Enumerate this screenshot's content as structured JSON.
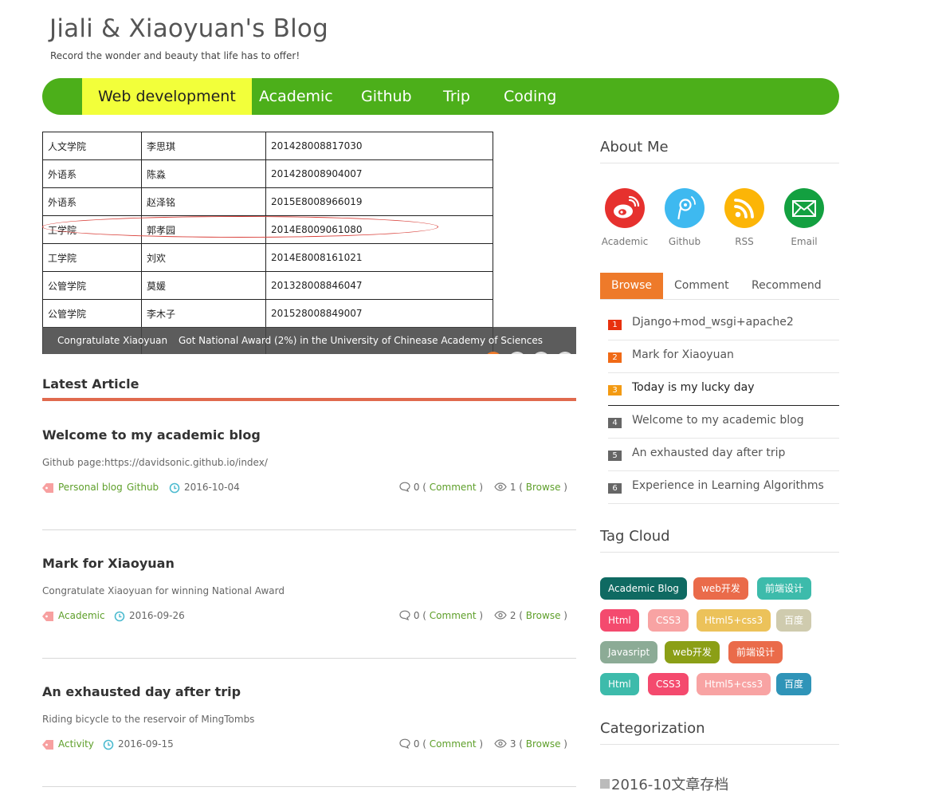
{
  "header": {
    "title": "Jiali & Xiaoyuan's Blog",
    "subtitle": "Record the wonder and beauty that life has to offer!"
  },
  "nav": {
    "items": [
      {
        "label": "Web development"
      },
      {
        "label": "Academic"
      },
      {
        "label": "Github"
      },
      {
        "label": "Trip"
      },
      {
        "label": "Coding"
      }
    ],
    "active_index": 0,
    "colors": {
      "bar": "#4caf1a",
      "active": "#f2ff3a"
    }
  },
  "slider": {
    "table": [
      [
        "人文学院",
        "李思琪",
        "201428008817030"
      ],
      [
        "外语系",
        "陈淼",
        "201428008904007"
      ],
      [
        "外语系",
        "赵泽铭",
        "2015E8008966019"
      ],
      [
        "工学院",
        "郭孝园",
        "2014E8009061080"
      ],
      [
        "工学院",
        "刘欢",
        "2014E8008161021"
      ],
      [
        "公管学院",
        "莫媛",
        "201328008846047"
      ],
      [
        "公管学院",
        "李木子",
        "201528008849007"
      ]
    ],
    "highlighted_row": 3,
    "caption_title": "Congratulate Xiaoyuan",
    "caption_text": "Got National Award (2%) in the University of Chinease Academy of Sciences",
    "active_dot": 0,
    "dot_count": 4
  },
  "latest": {
    "heading": "Latest Article",
    "articles": [
      {
        "title": "Welcome to my academic blog",
        "desc": "Github page:https://davidsonic.github.io/index/",
        "tags": [
          "Personal blog",
          "Github"
        ],
        "date": "2016-10-04",
        "comments": "0",
        "comment_label": "Comment",
        "browses": "1",
        "browse_label": "Browse"
      },
      {
        "title": "Mark for Xiaoyuan",
        "desc": "Congratulate Xiaoyuan for winning National Award",
        "tags": [
          "Academic"
        ],
        "date": "2016-09-26",
        "comments": "0",
        "comment_label": "Comment",
        "browses": "2",
        "browse_label": "Browse"
      },
      {
        "title": "An exhausted day after trip",
        "desc": "Riding bicycle to the reservoir of MingTombs",
        "tags": [
          "Activity"
        ],
        "date": "2016-09-15",
        "comments": "0",
        "comment_label": "Comment",
        "browses": "3",
        "browse_label": "Browse"
      }
    ]
  },
  "sidebar": {
    "about_heading": "About Me",
    "social": [
      {
        "label": "Academic",
        "icon": "weibo-icon",
        "color": "#e6312e"
      },
      {
        "label": "Github",
        "icon": "tencent-weibo-icon",
        "color": "#3eb9f0"
      },
      {
        "label": "RSS",
        "icon": "rss-icon",
        "color": "#fcb507"
      },
      {
        "label": "Email",
        "icon": "email-icon",
        "color": "#13a040"
      }
    ],
    "tabs": [
      "Browse",
      "Comment",
      "Recommend"
    ],
    "active_tab": 0,
    "rank": [
      {
        "num": "1",
        "title": "Django+mod_wsgi+apache2",
        "color": "#e8310e"
      },
      {
        "num": "2",
        "title": "Mark for Xiaoyuan",
        "color": "#f06a16"
      },
      {
        "num": "3",
        "title": "Today is my lucky day",
        "color": "#f39a12"
      },
      {
        "num": "4",
        "title": "Welcome to my academic blog",
        "color": "#666666"
      },
      {
        "num": "5",
        "title": "An exhausted day after trip",
        "color": "#666666"
      },
      {
        "num": "6",
        "title": "Experience in Learning Algorithms",
        "color": "#666666"
      }
    ],
    "tag_heading": "Tag Cloud",
    "tags": [
      {
        "label": "Academic Blog",
        "color": "#0f6a62"
      },
      {
        "label": "web开发",
        "color": "#ea6b4a"
      },
      {
        "label": "前端设计",
        "color": "#3dbbab"
      },
      {
        "label": "Html",
        "color": "#f44a6e"
      },
      {
        "label": "CSS3",
        "color": "#f8a3a3"
      },
      {
        "label": "Html5+css3",
        "color": "#ecc25a"
      },
      {
        "label": "百度",
        "color": "#cfcbae"
      },
      {
        "label": "Javasript",
        "color": "#8cab96"
      },
      {
        "label": "web开发",
        "color": "#8b9f16"
      },
      {
        "label": "前端设计",
        "color": "#ea6b4a"
      },
      {
        "label": "Html",
        "color": "#3dbbab"
      },
      {
        "label": "CSS3",
        "color": "#f44a6e"
      },
      {
        "label": "Html5+css3",
        "color": "#f8a3a3"
      },
      {
        "label": "百度",
        "color": "#2f94b8"
      }
    ],
    "cat_heading": "Categorization",
    "categories": [
      {
        "label": "2016-10文章存档"
      }
    ]
  }
}
